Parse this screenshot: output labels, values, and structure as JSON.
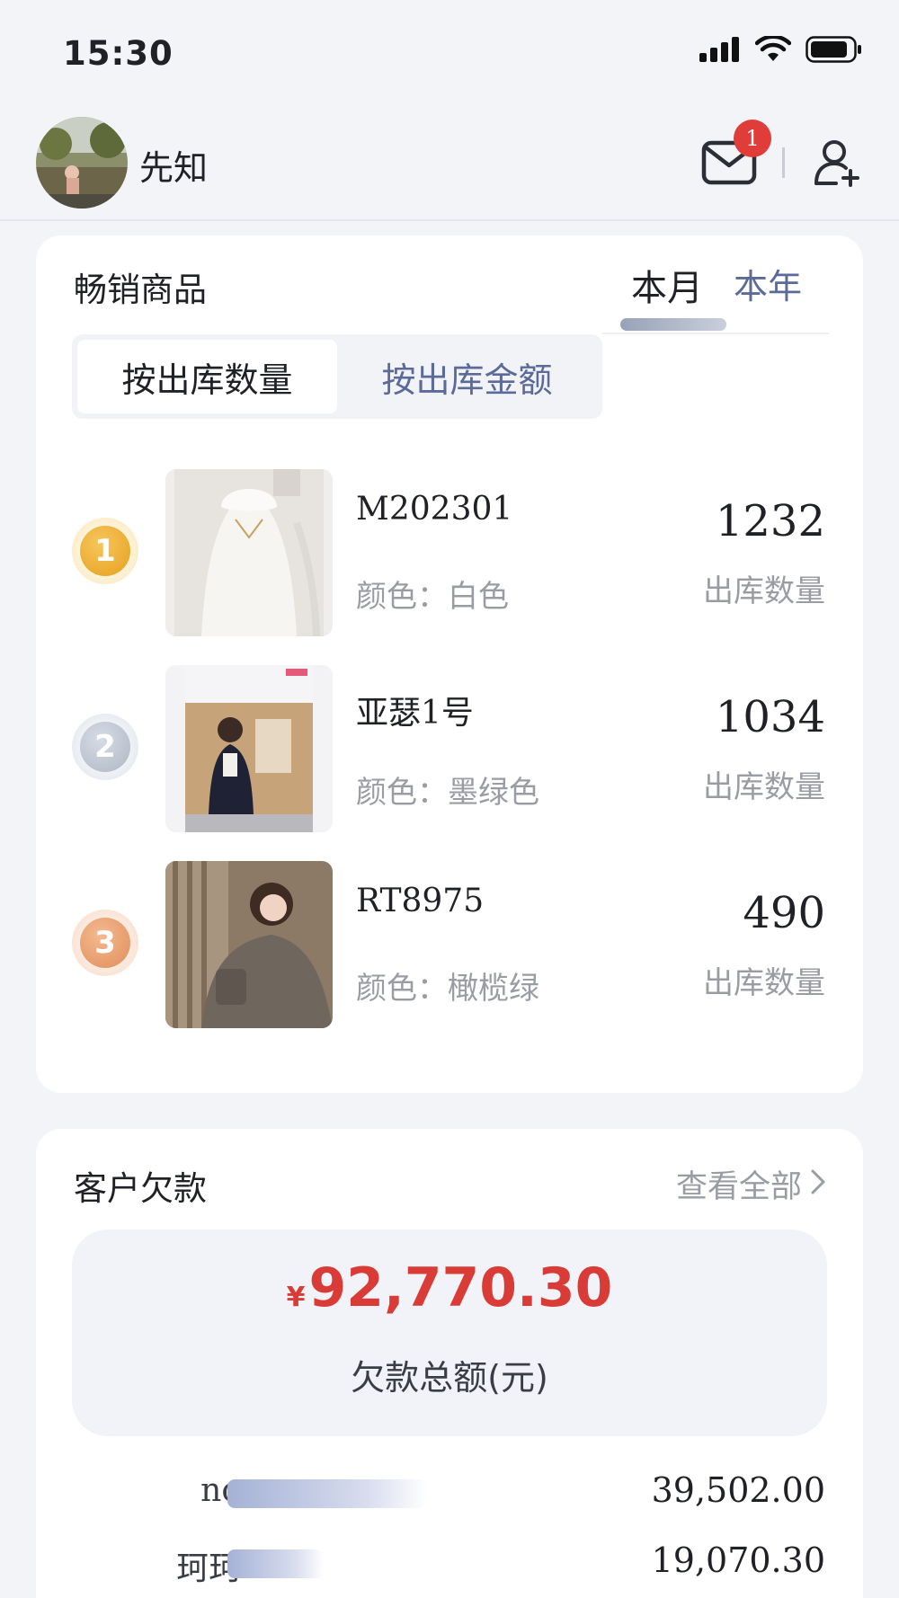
{
  "status_bar": {
    "time": "15:30"
  },
  "header": {
    "user_name": "先知",
    "mail_badge": "1"
  },
  "best_sellers": {
    "title": "畅销商品",
    "period_tabs": [
      "本月",
      "本年"
    ],
    "sort_tabs": [
      "按出库数量",
      "按出库金额"
    ],
    "products": [
      {
        "rank": "1",
        "name": "M202301",
        "color": "颜色：白色",
        "qty": "1232",
        "qty_label": "出库数量"
      },
      {
        "rank": "2",
        "name": "亚瑟1号",
        "color": "颜色：墨绿色",
        "qty": "1034",
        "qty_label": "出库数量"
      },
      {
        "rank": "3",
        "name": "RT8975",
        "color": "颜色：橄榄绿",
        "qty": "490",
        "qty_label": "出库数量"
      }
    ]
  },
  "customer_debt": {
    "title": "客户欠款",
    "view_all": "查看全部",
    "currency_symbol": "¥",
    "total_amount": "92,770.30",
    "total_label": "欠款总额(元)",
    "debtors": [
      {
        "name": "no",
        "amount": "39,502.00",
        "share": 0.426
      },
      {
        "name": "珂珂",
        "amount": "19,070.30",
        "share": 0.206
      }
    ]
  }
}
